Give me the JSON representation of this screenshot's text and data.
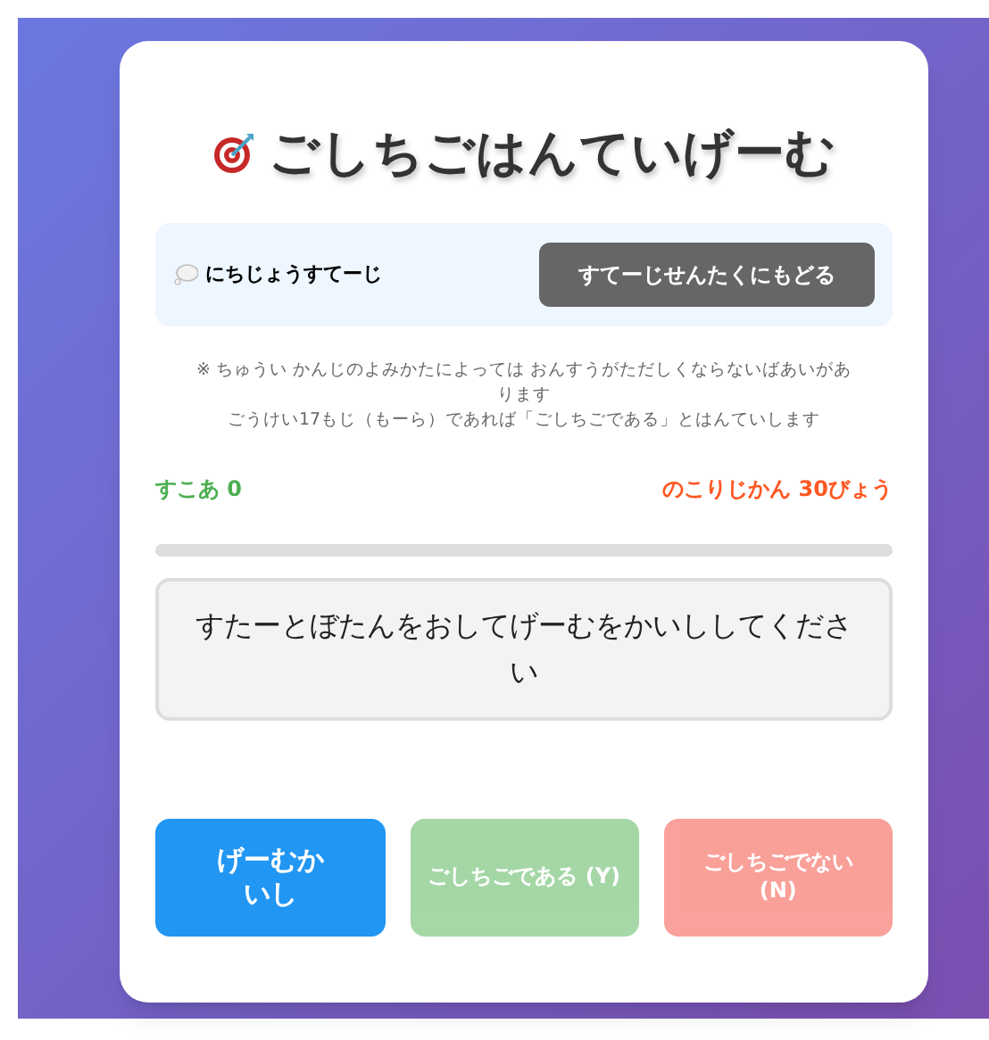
{
  "title": "ごしちごはんていげーむ",
  "stage": {
    "label": "にちじょうすてーじ",
    "back_button": "すてーじせんたくにもどる"
  },
  "notes": [
    "※ ちゅうい かんじのよみかたによっては おんすうがただしくならないばあいがあります",
    "ごうけい17もじ（もーら）であれば「ごしちごである」とはんていします"
  ],
  "score": "すこあ 0",
  "time_left": "のこりじかん 30びょう",
  "progress": {
    "level": 0
  },
  "question": "すたーとぼたんをおしてげーむをかいししてください",
  "buttons": [
    {
      "kind": "start",
      "label": "げーむかいし",
      "disabled": false
    },
    {
      "kind": "yes",
      "label": "ごしちごである (Y)",
      "disabled": true
    },
    {
      "kind": "no",
      "label": "ごしちごでない (N)",
      "disabled": true
    }
  ]
}
